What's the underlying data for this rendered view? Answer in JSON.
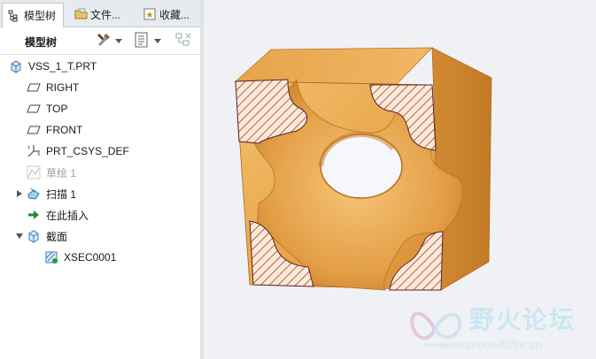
{
  "tabs": [
    {
      "label": "模型树",
      "icon": "model-tree-icon",
      "active": true
    },
    {
      "label": "文件...",
      "icon": "folder-icon",
      "active": false
    },
    {
      "label": "收藏...",
      "icon": "favorites-icon",
      "active": false
    }
  ],
  "toolbar": {
    "label": "模型树",
    "settings_icon": "tools-icon",
    "show_icon": "list-icon",
    "filter_icon": "filter-icon"
  },
  "tree": {
    "root": {
      "label": "VSS_1_T.PRT",
      "icon": "part-icon"
    },
    "items": [
      {
        "label": "RIGHT",
        "icon": "datum-plane-icon",
        "disabled": false
      },
      {
        "label": "TOP",
        "icon": "datum-plane-icon",
        "disabled": false
      },
      {
        "label": "FRONT",
        "icon": "datum-plane-icon",
        "disabled": false
      },
      {
        "label": "PRT_CSYS_DEF",
        "icon": "csys-icon",
        "disabled": false
      },
      {
        "label": "草绘 1",
        "icon": "sketch-icon",
        "disabled": true
      },
      {
        "label": "扫描 1",
        "icon": "sweep-icon",
        "disabled": false,
        "expandable": true
      },
      {
        "label": "在此插入",
        "icon": "insert-arrow-icon",
        "disabled": false
      },
      {
        "label": "截面",
        "icon": "section-icon",
        "disabled": false,
        "expanded": true
      },
      {
        "label": "XSEC0001",
        "icon": "xsection-icon",
        "disabled": false
      }
    ]
  },
  "watermark": {
    "title": "野火论坛",
    "url": "www.proewildfire.cn"
  },
  "colors": {
    "solid": "#e8a64c",
    "hatch": "#8b2a2a",
    "background": "#f0f1f4"
  }
}
